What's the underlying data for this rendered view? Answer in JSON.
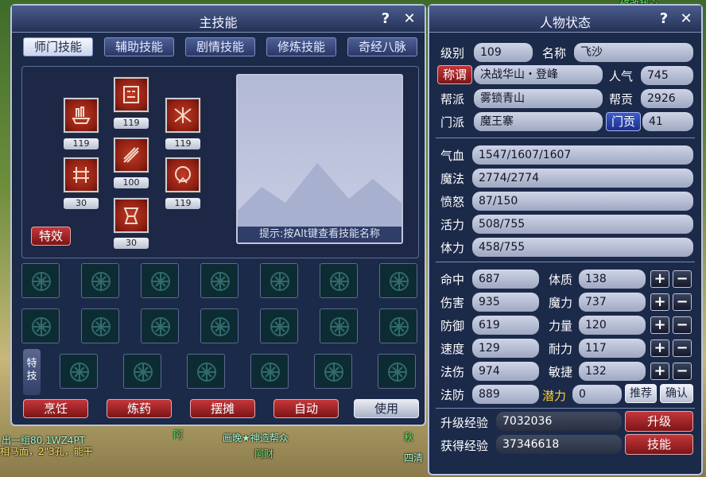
{
  "background": {
    "texts": [
      "出一组80,1WZ4PT",
      "相马面，2\"3孔，能干",
      "阿",
      "画晚★神造帮众",
      "阿财",
      "秋",
      "四清",
      "修改我心"
    ]
  },
  "skill_window": {
    "title": "主技能",
    "help": "?",
    "close": "✕",
    "tabs": [
      "师门技能",
      "辅助技能",
      "剧情技能",
      "修炼技能",
      "奇经八脉"
    ],
    "skills": [
      {
        "level": "119"
      },
      {
        "level": "119"
      },
      {
        "level": "119"
      },
      {
        "level": "30"
      },
      {
        "level": "100"
      },
      {
        "level": "119"
      },
      {
        "level": "30"
      }
    ],
    "special_button": "特效",
    "preview_hint": "提示:按Alt键查看技能名称",
    "teji_tab": "特技",
    "bottom_buttons": [
      "烹饪",
      "炼药",
      "摆摊",
      "自动",
      "使用"
    ]
  },
  "status_window": {
    "title": "人物状态",
    "help": "?",
    "close": "✕",
    "rows": {
      "level_label": "级别",
      "level": "109",
      "name_label": "名称",
      "name": "飞沙",
      "title_button": "称谓",
      "title_value": "决战华山・登峰",
      "popularity_label": "人气",
      "popularity": "745",
      "gang_label": "帮派",
      "gang": "雾锁青山",
      "contribution_label": "帮贡",
      "contribution": "2926",
      "sect_label": "门派",
      "sect": "魔王寨",
      "sect_contrib_button": "门贡",
      "sect_contrib": "41"
    },
    "vitals": [
      {
        "label": "气血",
        "value": "1547/1607/1607"
      },
      {
        "label": "魔法",
        "value": "2774/2774"
      },
      {
        "label": "愤怒",
        "value": "87/150"
      },
      {
        "label": "活力",
        "value": "508/755"
      },
      {
        "label": "体力",
        "value": "458/755"
      }
    ],
    "combat": [
      {
        "label": "命中",
        "value": "687"
      },
      {
        "label": "伤害",
        "value": "935"
      },
      {
        "label": "防御",
        "value": "619"
      },
      {
        "label": "速度",
        "value": "129"
      },
      {
        "label": "法伤",
        "value": "974"
      },
      {
        "label": "法防",
        "value": "889"
      }
    ],
    "attributes": [
      {
        "label": "体质",
        "value": "138"
      },
      {
        "label": "魔力",
        "value": "737"
      },
      {
        "label": "力量",
        "value": "120"
      },
      {
        "label": "耐力",
        "value": "117"
      },
      {
        "label": "敏捷",
        "value": "132"
      }
    ],
    "potential_label": "潜力",
    "potential": "0",
    "recommend_button": "推荐",
    "confirm_button": "确认",
    "plus": "+",
    "minus": "−",
    "upgrade_exp_label": "升级经验",
    "upgrade_exp": "7032036",
    "gained_exp_label": "获得经验",
    "gained_exp": "37346618",
    "upgrade_button": "升级",
    "skills_button": "技能"
  }
}
